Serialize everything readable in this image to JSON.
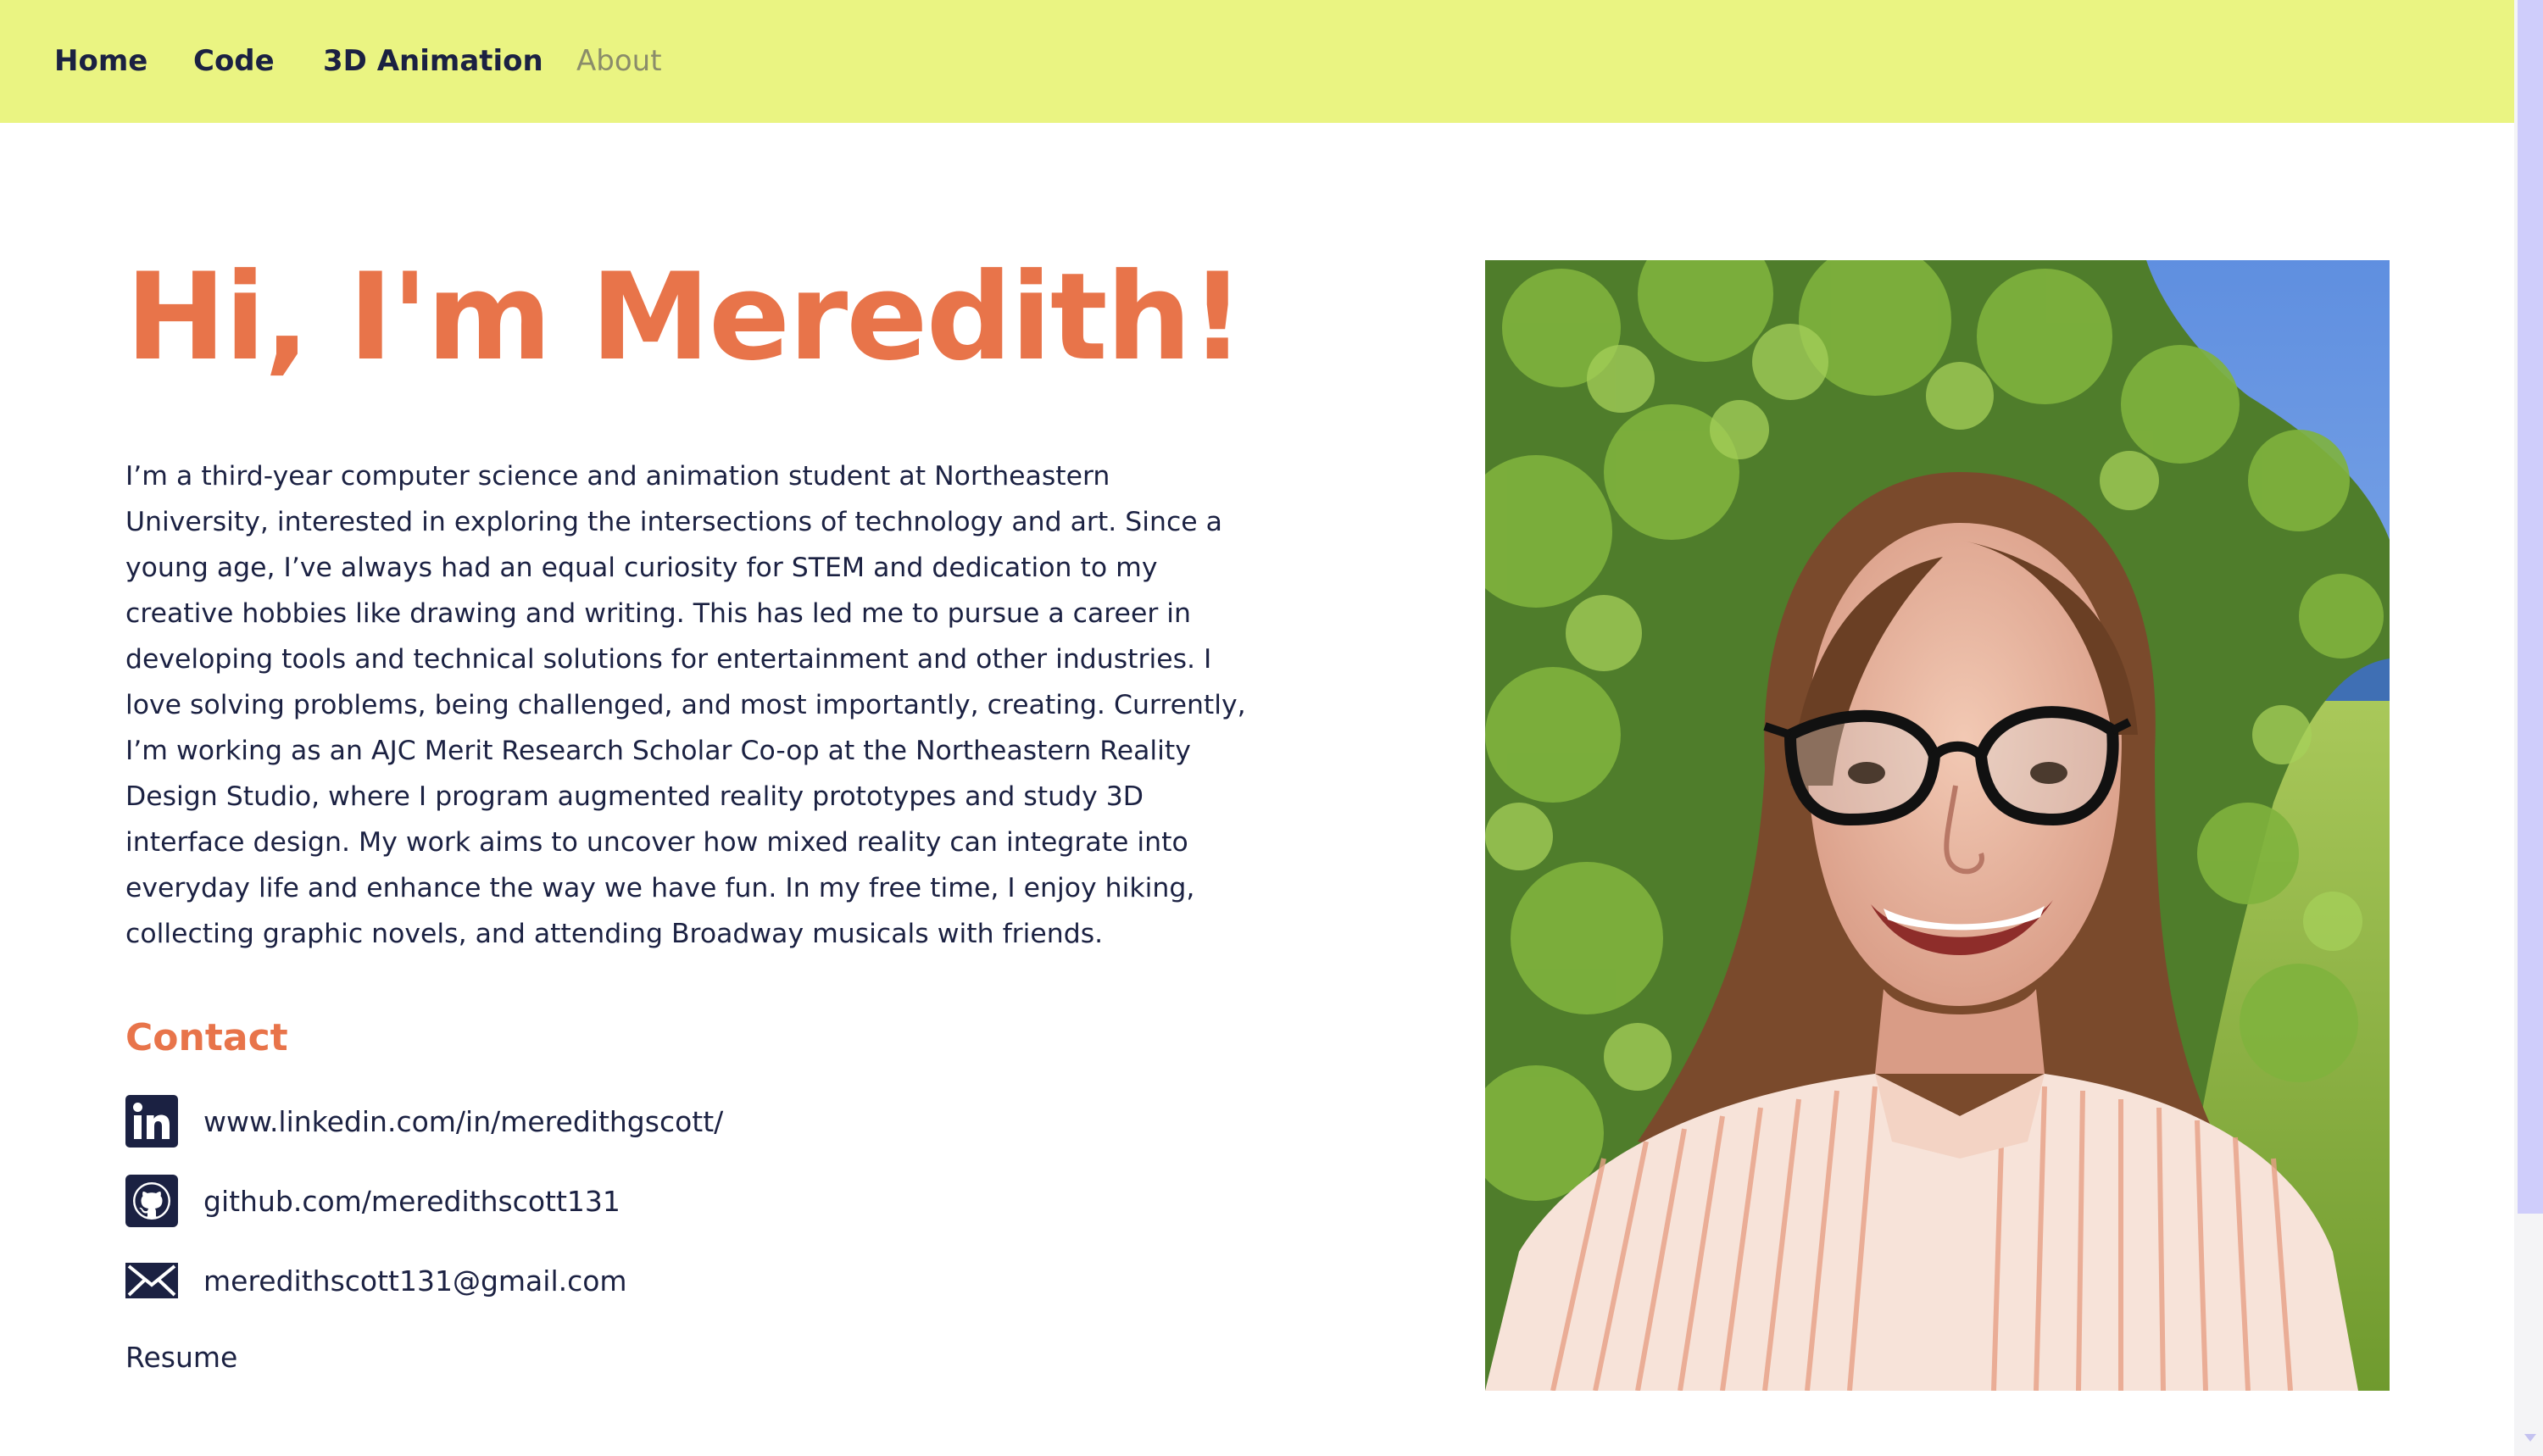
{
  "nav": {
    "items": [
      {
        "label": "Home"
      },
      {
        "label": "Code"
      },
      {
        "label": "3D Animation"
      },
      {
        "label": "About"
      }
    ],
    "active": "About"
  },
  "hero": {
    "title": "Hi, I'm Meredith!",
    "bio": "I’m a third-year computer science and animation student at Northeastern University, interested in exploring the intersections of technology and art. Since a young age, I’ve always had an equal curiosity for STEM and dedication to my creative hobbies like drawing and writing. This has led me to pursue a career in developing tools and technical solutions for entertainment and other industries. I love solving problems, being challenged, and most importantly, creating. Currently, I’m working as an AJC Merit Research Scholar Co-op at the Northeastern Reality Design Studio, where I program augmented reality prototypes and study 3D interface design. My work aims to uncover how mixed reality can integrate into everyday life and enhance the way we have fun. In my free time, I enjoy hiking, collecting graphic novels, and attending Broadway musicals with friends."
  },
  "contact": {
    "heading": "Contact",
    "items": [
      {
        "icon": "linkedin-icon",
        "text": "www.linkedin.com/in/meredithgscott/"
      },
      {
        "icon": "github-icon",
        "text": "github.com/meredithscott131"
      },
      {
        "icon": "mail-icon",
        "text": "meredithscott131@gmail.com"
      }
    ],
    "resume": "Resume"
  },
  "colors": {
    "nav_bg": "#eaf482",
    "accent": "#e8744a",
    "text": "#1b2142",
    "nav_active": "#8a8c6a",
    "scrollbar_thumb": "#cfcdfb"
  }
}
